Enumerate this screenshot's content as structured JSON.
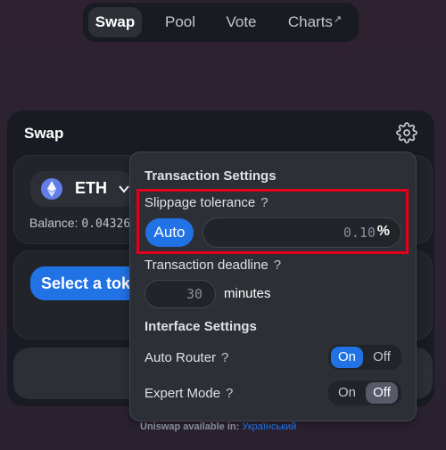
{
  "nav": {
    "items": [
      "Swap",
      "Pool",
      "Vote",
      "Charts"
    ],
    "external_arrow": "↗"
  },
  "swap_card": {
    "title": "Swap",
    "input": {
      "token_symbol": "ETH",
      "balance_label": "Balance:",
      "balance_value": "0.04326"
    },
    "output": {
      "select_token_label": "Select a token"
    }
  },
  "settings": {
    "transaction_title": "Transaction Settings",
    "slippage_label": "Slippage tolerance",
    "help_mark": "?",
    "auto_label": "Auto",
    "slippage_placeholder": "0.10",
    "percent": "%",
    "deadline_label": "Transaction deadline",
    "deadline_placeholder": "30",
    "minutes_label": "minutes",
    "interface_title": "Interface Settings",
    "auto_router_label": "Auto Router",
    "auto_router_state": "On",
    "expert_mode_label": "Expert Mode",
    "expert_mode_state": "Off",
    "on_label": "On",
    "off_label": "Off"
  },
  "footer": {
    "prefix": "Uniswap available in:",
    "language": "Український"
  },
  "colors": {
    "accent": "#2172e5",
    "highlight": "#e3001b"
  }
}
